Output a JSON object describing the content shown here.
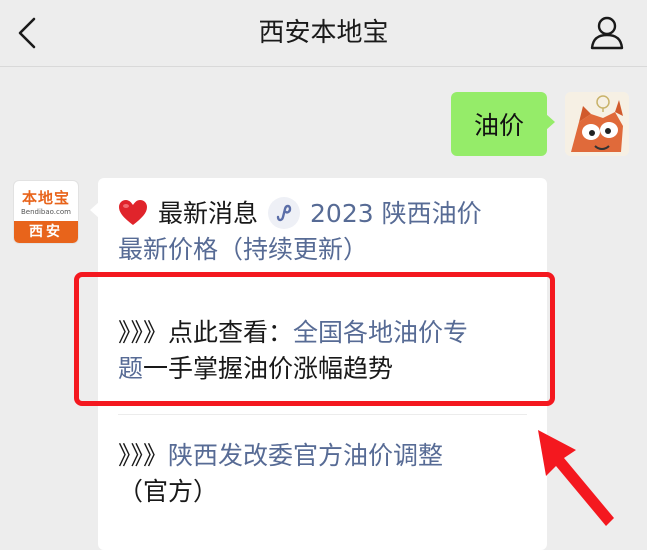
{
  "header": {
    "title": "西安本地宝"
  },
  "outgoing": {
    "text": "油价"
  },
  "incoming": {
    "avatar": {
      "logo_text": "本地宝",
      "logo_sub": "Bendibao.com",
      "city": "西安"
    },
    "news": {
      "label": "最新消息",
      "link_line1": "2023 陕西油价",
      "link_line2": "最新价格（持续更新）"
    },
    "item1": {
      "prefix": "》》》点此查看：",
      "link_part1": "全国各地油价专",
      "link_part2": "题",
      "suffix": "一手掌握油价涨幅趋势"
    },
    "item2": {
      "prefix": "》》》",
      "link": "陕西发改委官方油价调整",
      "suffix": "（官方）"
    }
  },
  "colors": {
    "outgoing_bubble": "#95ec69",
    "link": "#576b95",
    "highlight": "#f4181f",
    "brand": "#e8641b"
  },
  "icons": {
    "back": "chevron-left-icon",
    "profile": "person-icon",
    "heart": "heart-icon",
    "mini_program": "mini-program-icon"
  }
}
